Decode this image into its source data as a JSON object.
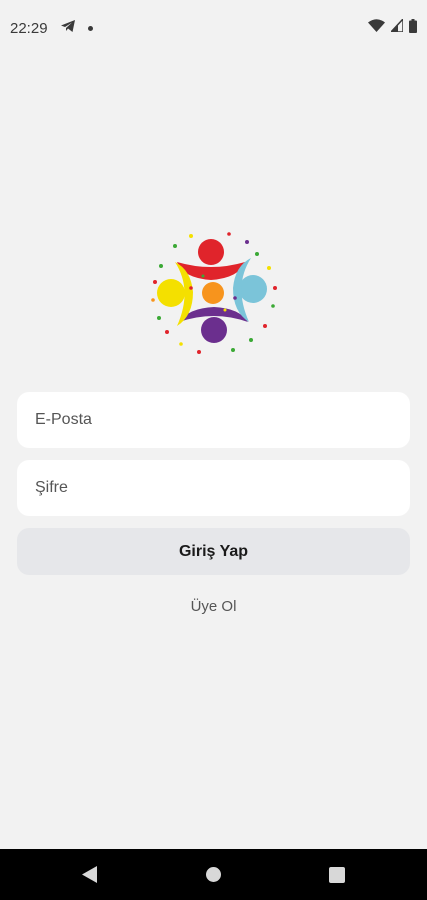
{
  "status_bar": {
    "time": "22:29",
    "icons": [
      "telegram-icon",
      "notification-dot-icon",
      "wifi-icon",
      "signal-icon",
      "battery-icon"
    ]
  },
  "logo": {
    "name": "logo-icon",
    "colors": [
      "#e0242b",
      "#f4e000",
      "#7bc4d9",
      "#6b2f8e",
      "#f7941d",
      "#3ba935"
    ]
  },
  "form": {
    "email_placeholder": "E-Posta",
    "password_placeholder": "Şifre",
    "login_label": "Giriş Yap",
    "register_label": "Üye Ol"
  },
  "nav_bar": {
    "icons": [
      "back-icon",
      "home-icon",
      "recents-icon"
    ]
  },
  "colors": {
    "background": "#f2f2f2",
    "field": "#ffffff",
    "button": "#e6e7ea"
  }
}
